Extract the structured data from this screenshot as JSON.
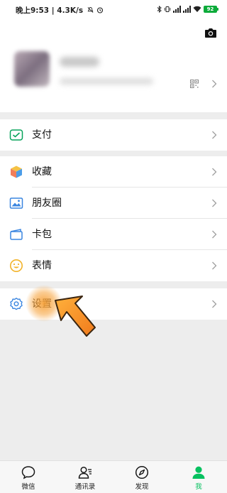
{
  "status_bar": {
    "time_text": "晚上9:53 | 4.3K/s",
    "battery": "92"
  },
  "menu": {
    "pay": "支付",
    "favorites": "收藏",
    "moments": "朋友圈",
    "cards": "卡包",
    "stickers": "表情",
    "settings": "设置"
  },
  "tabs": {
    "chats": "微信",
    "contacts": "通讯录",
    "discover": "发现",
    "me": "我",
    "active": "我"
  },
  "colors": {
    "accent": "#07c160",
    "background": "#ededed"
  }
}
